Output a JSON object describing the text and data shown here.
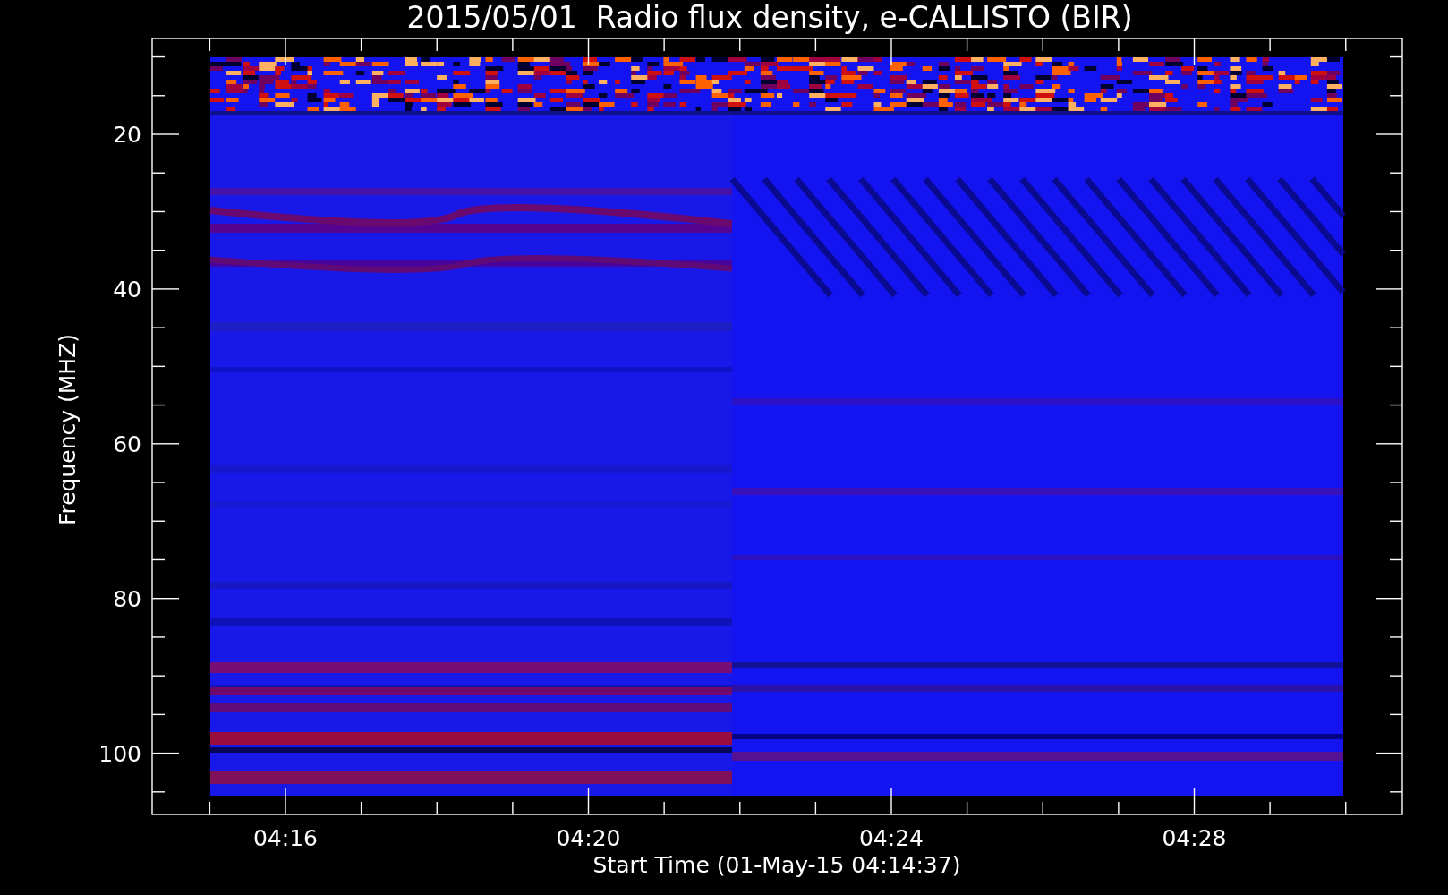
{
  "title": "2015/05/01  Radio flux density, e-CALLISTO (BIR)",
  "plot": {
    "xlabel": "Start Time (01-May-15 04:14:37)",
    "ylabel": "Frequency (MHZ)",
    "yticks": [
      "20",
      "40",
      "60",
      "80",
      "100"
    ],
    "xticks": [
      "04:16",
      "04:20",
      "04:24",
      "04:28"
    ]
  }
}
